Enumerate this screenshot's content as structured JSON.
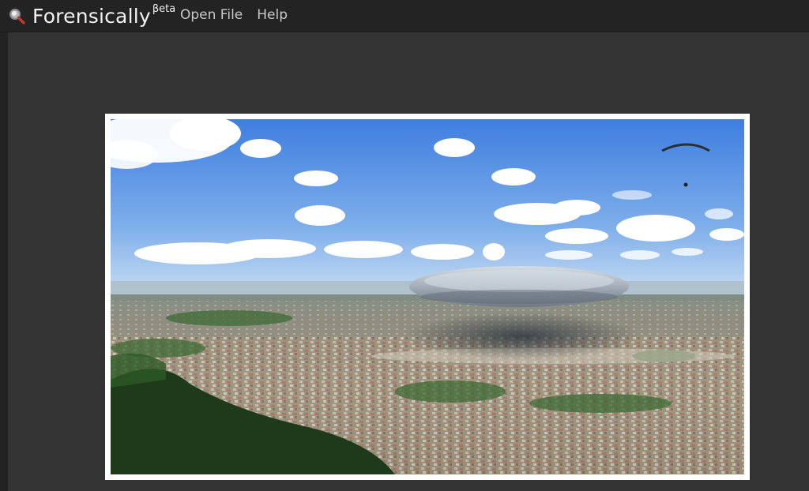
{
  "app": {
    "title": "Forensically",
    "badge": "βeta",
    "logo_icon": "magnifier-icon"
  },
  "menu": {
    "items": [
      {
        "label": "Open File",
        "icon": null
      },
      {
        "label": "Help",
        "icon": null
      }
    ]
  },
  "image": {
    "subject": "aerial city view with flying saucer",
    "colors": {
      "sky_top": "#3f7fe0",
      "sky_bottom": "#c6dcf5",
      "ufo": "#a7b3bf",
      "forest": "#1f3a1a",
      "city": "#a69a86"
    }
  }
}
